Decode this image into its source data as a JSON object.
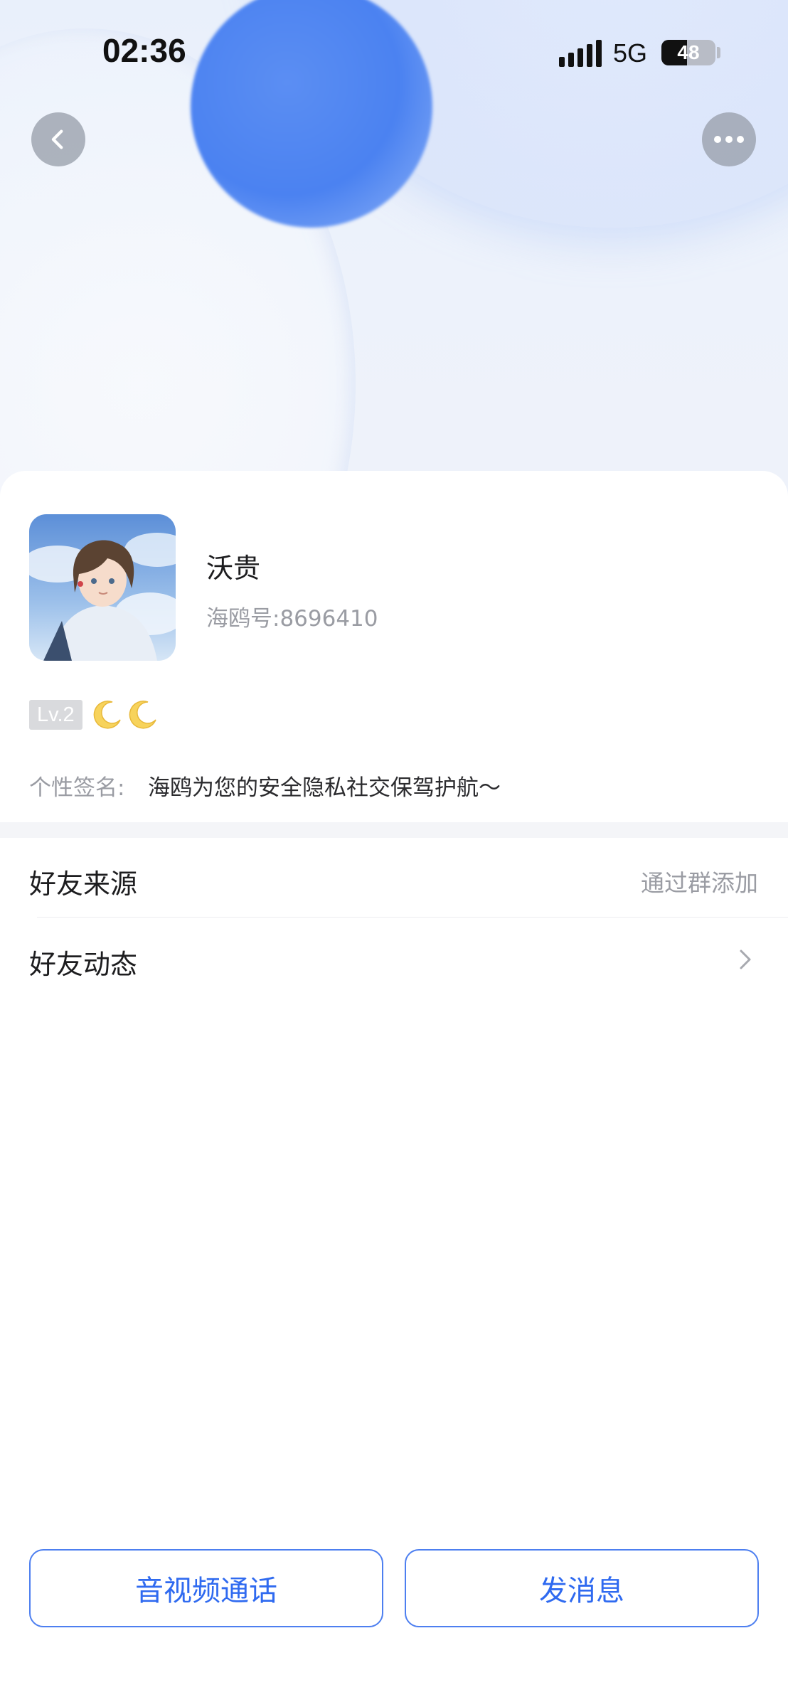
{
  "status_bar": {
    "time": "02:36",
    "network": "5G",
    "battery": "48",
    "battery_level": 0.48
  },
  "nav": {
    "back_icon": "chevron-left-icon",
    "more_icon": "more-dots-icon"
  },
  "profile": {
    "name": "沃贵",
    "account_id": "海鸥号:8696410",
    "level": "Lv.2",
    "level_icons": [
      "moon-icon",
      "moon-icon"
    ],
    "signature_label": "个性签名:",
    "signature": "海鸥为您的安全隐私社交保驾护航～"
  },
  "rows": [
    {
      "label": "好友来源",
      "value": "通过群添加"
    },
    {
      "label": "好友动态",
      "value": "",
      "icon": "chevron-right-icon"
    }
  ],
  "actions": {
    "call_label": "音视频通话",
    "message_label": "发消息",
    "accent_color": "#2f6af0"
  }
}
